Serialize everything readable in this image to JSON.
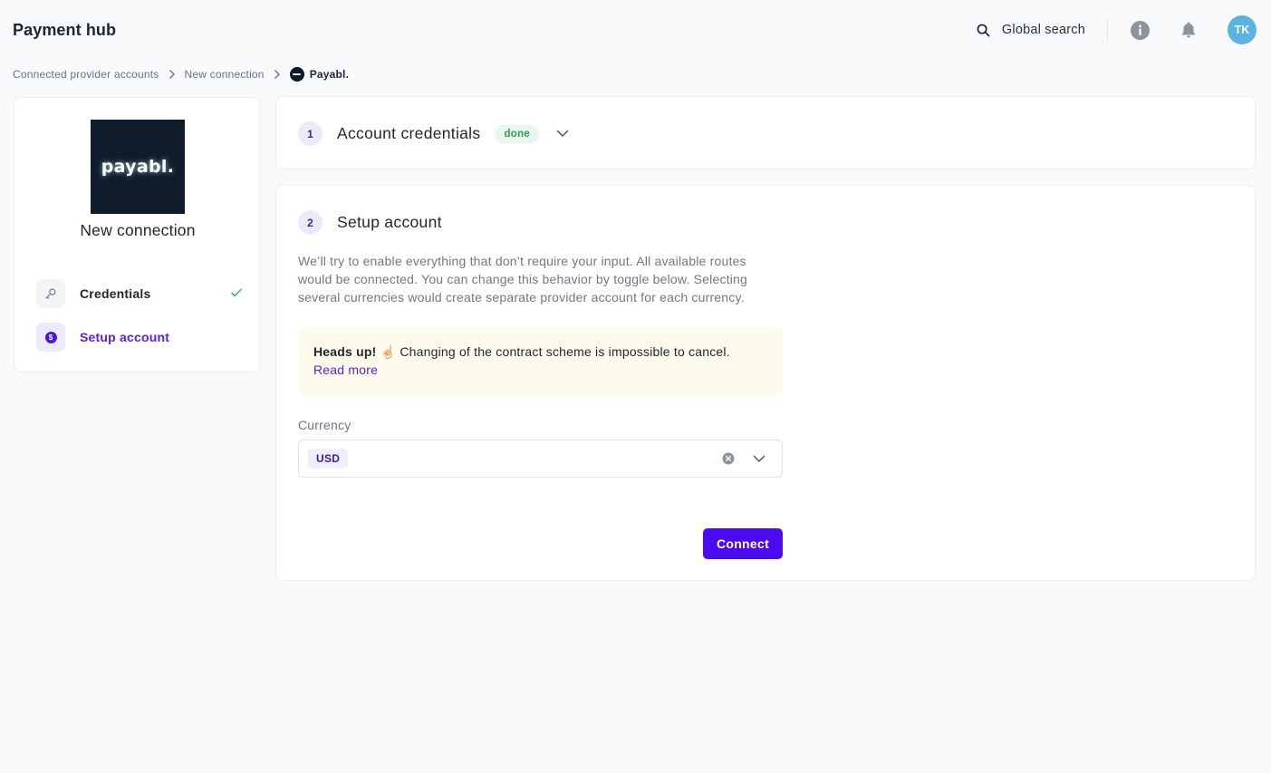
{
  "header": {
    "app_title": "Payment hub",
    "search_label": "Global search",
    "user_initials": "TK"
  },
  "breadcrumb": {
    "items": [
      "Connected provider accounts",
      "New connection"
    ],
    "current": "Payabl."
  },
  "sidebar": {
    "logo_text": "payabl.",
    "title": "New connection",
    "steps": [
      {
        "label": "Credentials",
        "status": "complete",
        "icon": "key-icon"
      },
      {
        "label": "Setup account",
        "status": "active",
        "icon": "coin-icon"
      }
    ]
  },
  "credentials_section": {
    "number": "1",
    "title": "Account credentials",
    "badge": "done"
  },
  "setup_section": {
    "number": "2",
    "title": "Setup account",
    "description": "We’ll try to enable everything that don’t require your input. All available routes would be connected. You can change this behavior by toggle below. Selecting several currencies would create separate provider account for each currency.",
    "alert": {
      "strong": "Heads up!",
      "emoji": "☝🏻",
      "text": "Changing of the contract scheme is impossible to cancel.",
      "link": "Read more"
    },
    "currency": {
      "label": "Currency",
      "selected": [
        "USD"
      ]
    },
    "submit_label": "Connect"
  },
  "colors": {
    "accent": "#4b0af0",
    "accent_text": "#5a1fd8",
    "success": "#2e9b54",
    "avatar": "#5ab4e2",
    "alert_bg": "#fdfbeb"
  }
}
